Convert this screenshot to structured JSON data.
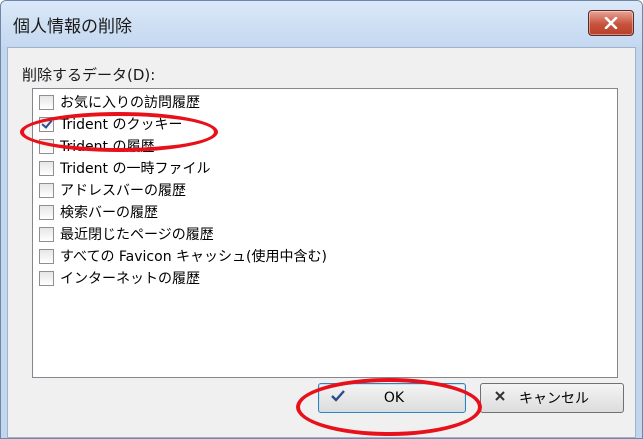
{
  "dialog": {
    "title": "個人情報の削除",
    "list_label": "削除するデータ(D):",
    "items": [
      {
        "label": "お気に入りの訪問履歴",
        "checked": false
      },
      {
        "label": "Trident のクッキー",
        "checked": true
      },
      {
        "label": "Trident の履歴",
        "checked": false
      },
      {
        "label": "Trident の一時ファイル",
        "checked": false
      },
      {
        "label": "アドレスバーの履歴",
        "checked": false
      },
      {
        "label": "検索バーの履歴",
        "checked": false
      },
      {
        "label": "最近閉じたページの履歴",
        "checked": false
      },
      {
        "label": "すべての Favicon キャッシュ(使用中含む)",
        "checked": false
      },
      {
        "label": "インターネットの履歴",
        "checked": false
      }
    ],
    "ok_label": "OK",
    "cancel_label": "キャンセル"
  },
  "icons": {
    "close": "close-icon",
    "ok": "check-icon",
    "cancel": "cross-icon"
  },
  "colors": {
    "annotation": "#e8101a",
    "close_button": "#c7533d",
    "titlebar": "#c4d8f0"
  }
}
